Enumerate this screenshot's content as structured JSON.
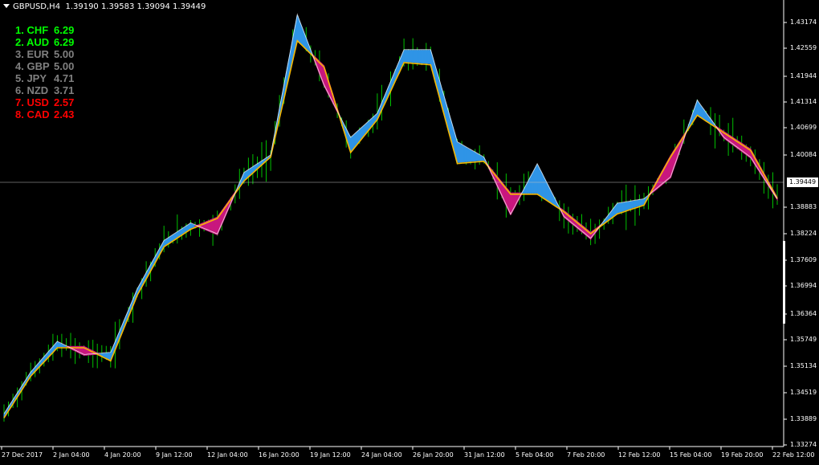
{
  "header": {
    "symbol_timeframe": "GBPUSD,H4",
    "ohlc": "1.39190 1.39583 1.39094 1.39449"
  },
  "strength_table": [
    {
      "rank": "1.",
      "currency": "CHF",
      "value": "6.29",
      "color": "#00ff00"
    },
    {
      "rank": "2.",
      "currency": "AUD",
      "value": "6.29",
      "color": "#00ff00"
    },
    {
      "rank": "3.",
      "currency": "EUR",
      "value": "5.00",
      "color": "#808080"
    },
    {
      "rank": "4.",
      "currency": "GBP",
      "value": "5.00",
      "color": "#808080"
    },
    {
      "rank": "5.",
      "currency": "JPY",
      "value": "4.71",
      "color": "#808080"
    },
    {
      "rank": "6.",
      "currency": "NZD",
      "value": "3.71",
      "color": "#808080"
    },
    {
      "rank": "7.",
      "currency": "USD",
      "value": "2.57",
      "color": "#ff0000"
    },
    {
      "rank": "8.",
      "currency": "CAD",
      "value": "2.43",
      "color": "#ff0000"
    }
  ],
  "price_axis": {
    "labels": [
      "1.43174",
      "1.42559",
      "1.41944",
      "1.41314",
      "1.40699",
      "1.40084",
      "1.38883",
      "1.38224",
      "1.37609",
      "1.36994",
      "1.36364",
      "1.35749",
      "1.35134",
      "1.34519",
      "1.33889",
      "1.33274"
    ],
    "current": "1.39449"
  },
  "time_axis": {
    "labels": [
      "27 Dec 2017",
      "2 Jan 04:00",
      "4 Jan 20:00",
      "9 Jan 12:00",
      "12 Jan 04:00",
      "16 Jan 20:00",
      "19 Jan 12:00",
      "24 Jan 04:00",
      "26 Jan 20:00",
      "31 Jan 12:00",
      "5 Feb 04:00",
      "7 Feb 20:00",
      "12 Feb 12:00",
      "15 Feb 04:00",
      "19 Feb 20:00",
      "22 Feb 12:00"
    ]
  },
  "colors": {
    "background": "#000000",
    "candles": "#00c000",
    "bull_band": "#2f94e6",
    "bear_band": "#c8177e",
    "fast_line_bull": "#ffffff",
    "slow_line": "#f5b800",
    "grid": "#ffffff"
  },
  "chart_data": {
    "type": "line",
    "title": "GBPUSD,H4",
    "ylim": [
      1.3327,
      1.4345
    ],
    "x": [
      "27 Dec 2017",
      "2 Jan 04:00",
      "4 Jan 20:00",
      "9 Jan 12:00",
      "12 Jan 04:00",
      "16 Jan 20:00",
      "19 Jan 12:00",
      "24 Jan 04:00",
      "26 Jan 20:00",
      "31 Jan 12:00",
      "5 Feb 04:00",
      "7 Feb 20:00",
      "12 Feb 12:00",
      "15 Feb 04:00",
      "19 Feb 20:00",
      "22 Feb 12:00"
    ],
    "series": [
      {
        "values": [
          1.34,
          1.3495,
          1.3565,
          1.3535,
          1.354,
          1.3685,
          1.3795,
          1.3835,
          1.381,
          1.395,
          1.399,
          1.431,
          1.415,
          1.403,
          1.4085,
          1.423,
          1.423,
          1.402,
          1.3985,
          1.3855,
          1.397,
          1.385,
          1.38,
          1.388,
          1.389,
          1.394,
          1.4115,
          1.403,
          1.3985,
          1.389
        ]
      },
      {
        "values": [
          1.3395,
          1.349,
          1.3555,
          1.3555,
          1.3525,
          1.3675,
          1.3785,
          1.3825,
          1.385,
          1.3935,
          1.399,
          1.4255,
          1.4195,
          1.4,
          1.4075,
          1.4205,
          1.42,
          1.3975,
          1.398,
          1.3905,
          1.3905,
          1.3865,
          1.3815,
          1.386,
          1.388,
          1.399,
          1.4085,
          1.4045,
          1.4005,
          1.3895
        ]
      }
    ],
    "last_price": 1.39449
  }
}
